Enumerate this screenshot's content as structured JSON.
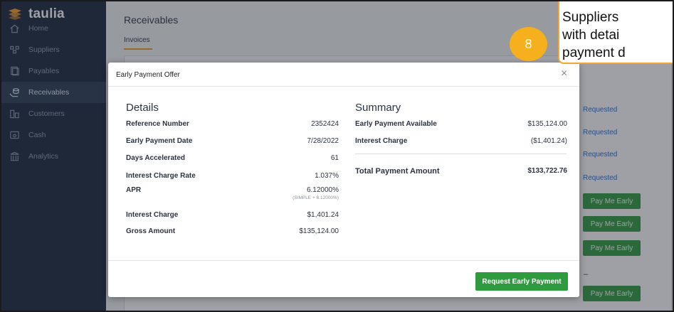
{
  "app": {
    "logo_text": "taulia",
    "logo_color": "#f59a24"
  },
  "sidebar": {
    "items": [
      {
        "label": "Home",
        "icon": "home-icon",
        "active": false
      },
      {
        "label": "Suppliers",
        "icon": "suppliers-icon",
        "active": false
      },
      {
        "label": "Payables",
        "icon": "payables-icon",
        "active": false
      },
      {
        "label": "Receivables",
        "icon": "receivables-icon",
        "active": true
      },
      {
        "label": "Customers",
        "icon": "customers-icon",
        "active": false
      },
      {
        "label": "Cash",
        "icon": "cash-icon",
        "active": false
      },
      {
        "label": "Analytics",
        "icon": "analytics-icon",
        "active": false
      }
    ]
  },
  "main": {
    "title": "Receivables",
    "tab": "Invoices",
    "statuses": [
      "Requested",
      "Requested",
      "Requested",
      "Requested"
    ],
    "pay_buttons": [
      "Pay Me Early",
      "Pay Me Early",
      "Pay Me Early",
      "Pay Me Early"
    ],
    "dash": "–"
  },
  "modal": {
    "title": "Early Payment Offer",
    "close_glyph": "×",
    "details": {
      "heading": "Details",
      "rows": [
        {
          "label": "Reference Number",
          "value": "2352424"
        },
        {
          "label": "Early Payment Date",
          "value": "7/28/2022"
        },
        {
          "label": "Days Accelerated",
          "value": "61"
        },
        {
          "label": "Interest Charge Rate",
          "value": "1.037%"
        },
        {
          "label": "APR",
          "value": "6.12000%",
          "sub": "(SIMPLE + 6.12000%)"
        },
        {
          "label": "Interest Charge",
          "value": "$1,401.24"
        },
        {
          "label": "Gross Amount",
          "value": "$135,124.00"
        }
      ]
    },
    "summary": {
      "heading": "Summary",
      "rows": [
        {
          "label": "Early Payment Available",
          "value": "$135,124.00"
        },
        {
          "label": "Interest Charge",
          "value": "($1,401.24)"
        }
      ],
      "total_label": "Total Payment Amount",
      "total_value": "$133,722.76"
    },
    "request_button": "Request Early Payment"
  },
  "step_badge": "8",
  "callout": {
    "text": "Suppliers\nwith detai\npayment d"
  },
  "colors": {
    "sidebar_bg": "#18263b",
    "accent": "#f59a24",
    "green_button": "#2e9b3e",
    "link_blue": "#2a6bd0",
    "badge": "#f6b01d"
  }
}
